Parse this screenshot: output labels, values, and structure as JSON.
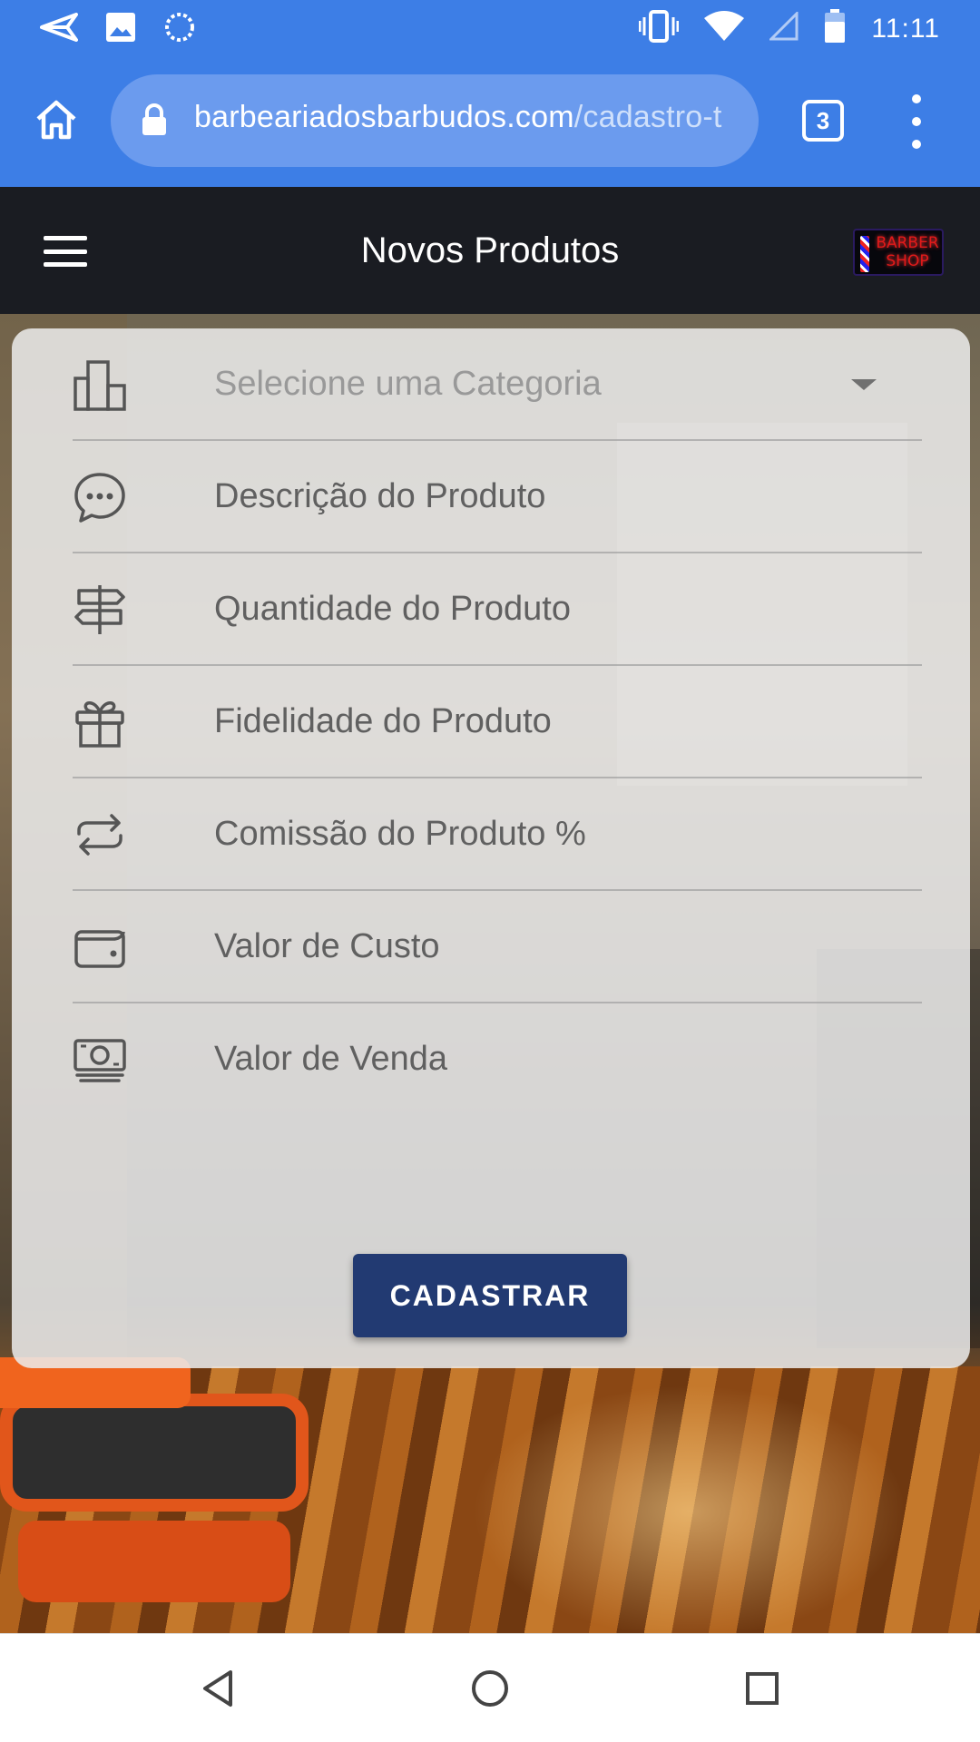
{
  "status_bar": {
    "time": "11:11",
    "left_icons": [
      "send-icon",
      "image-icon",
      "sync-icon"
    ],
    "right_icons": [
      "vibrate-icon",
      "wifi-icon",
      "signal-icon",
      "battery-icon"
    ]
  },
  "browser": {
    "url_host": "barbeariadosbarbudos.com",
    "url_path": "/cadastro-t",
    "tab_count": "3",
    "accent": "#3d7ee6"
  },
  "header": {
    "title": "Novos Produtos",
    "logo_text": "BARBER SHOP",
    "background": "#1a1c22"
  },
  "form": {
    "fields": [
      {
        "icon": "building-icon",
        "label": "Selecione uma Categoria",
        "type": "select"
      },
      {
        "icon": "chat-icon",
        "label": "Descrição do Produto",
        "type": "input"
      },
      {
        "icon": "signpost-icon",
        "label": "Quantidade do Produto",
        "type": "input"
      },
      {
        "icon": "gift-icon",
        "label": "Fidelidade do Produto",
        "type": "input"
      },
      {
        "icon": "repeat-icon",
        "label": "Comissão do Produto %",
        "type": "input"
      },
      {
        "icon": "wallet-icon",
        "label": "Valor de Custo",
        "type": "input"
      },
      {
        "icon": "cash-icon",
        "label": "Valor de Venda",
        "type": "input"
      }
    ],
    "submit_label": "CADASTRAR",
    "submit_color": "#223a72"
  },
  "nav": {
    "icons": [
      "back-icon",
      "home-circle-icon",
      "recents-icon"
    ]
  }
}
